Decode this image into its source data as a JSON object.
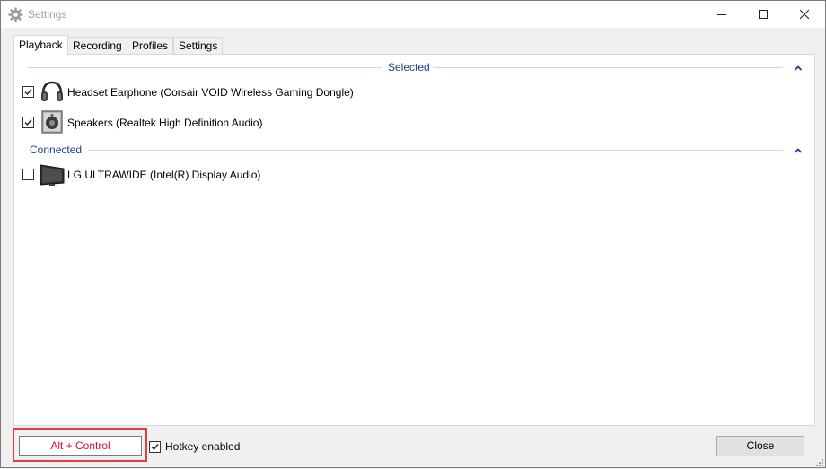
{
  "window": {
    "title": "Settings",
    "icon": "gear-icon",
    "controls": [
      "minimize-icon",
      "maximize-icon",
      "close-icon"
    ]
  },
  "tabs": [
    {
      "label": "Playback",
      "active": true
    },
    {
      "label": "Recording",
      "active": false
    },
    {
      "label": "Profiles",
      "active": false
    },
    {
      "label": "Settings",
      "active": false
    }
  ],
  "groups": {
    "selected": {
      "title": "Selected",
      "devices": [
        {
          "label": "Headset Earphone (Corsair VOID Wireless Gaming Dongle)",
          "checked": true,
          "icon": "headset-icon"
        },
        {
          "label": "Speakers (Realtek High Definition Audio)",
          "checked": true,
          "icon": "speaker-icon"
        }
      ]
    },
    "connected": {
      "title": "Connected",
      "devices": [
        {
          "label": "LG ULTRAWIDE (Intel(R) Display Audio)",
          "checked": false,
          "icon": "monitor-icon"
        }
      ]
    }
  },
  "footer": {
    "hotkey_value": "Alt + Control",
    "hotkey_enabled_label": "Hotkey enabled",
    "hotkey_enabled": true,
    "close_label": "Close"
  },
  "colors": {
    "group_title": "#1e3f8f",
    "hotkey_text": "#c6143c",
    "highlight_border": "#e0403a"
  }
}
